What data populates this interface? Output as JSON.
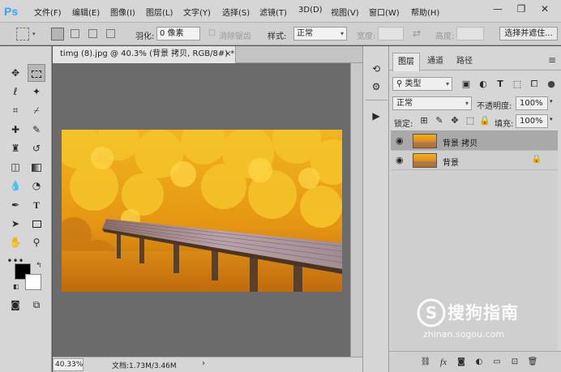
{
  "app": {
    "logo": "Ps"
  },
  "menu": [
    "文件(F)",
    "编辑(E)",
    "图像(I)",
    "图层(L)",
    "文字(Y)",
    "选择(S)",
    "滤镜(T)",
    "3D(D)",
    "视图(V)",
    "窗口(W)",
    "帮助(H)"
  ],
  "window_controls": {
    "minimize": "—",
    "restore": "❐",
    "close": "✕"
  },
  "options": {
    "feather_label": "羽化:",
    "feather_value": "0 像素",
    "antialias_label": "消除锯齿",
    "style_label": "样式:",
    "style_value": "正常",
    "width_label": "宽度:",
    "height_label": "高度:",
    "select_mask_button": "选择并遮住..."
  },
  "document": {
    "tab_title": "timg (8).jpg @ 40.3% (背景 拷贝, RGB/8#) *",
    "tab_close": "×",
    "zoom": "40.33%",
    "doc_info": "文档:1.73M/3.46M",
    "status_arrow": "›"
  },
  "layers_panel": {
    "tabs": [
      "图层",
      "通道",
      "路径"
    ],
    "active_tab": 0,
    "menu_glyph": "≡",
    "filter_kind": "类型",
    "blend_mode": "正常",
    "opacity_label": "不透明度:",
    "opacity_value": "100%",
    "lock_label": "锁定:",
    "fill_label": "填充:",
    "fill_value": "100%",
    "layers": [
      {
        "name": "背景 拷贝",
        "visible": true,
        "selected": true,
        "locked": false
      },
      {
        "name": "背景",
        "visible": true,
        "selected": false,
        "locked": true
      }
    ],
    "bottom_fx": "fx"
  },
  "watermark": {
    "main": "搜狗指南",
    "sub": "zhinan.sogou.com"
  },
  "colors": {
    "accent": "#31a8ff",
    "foreground_swatch": "#000000",
    "background_swatch": "#ffffff",
    "canvas_bg": "#6b6b6b",
    "panel_bg": "#d6d6d6"
  },
  "icons": {
    "tools": [
      "move-icon",
      "marquee-icon",
      "lasso-icon",
      "magic-wand-icon",
      "crop-icon",
      "eyedropper-icon",
      "healing-brush-icon",
      "brush-icon",
      "clone-stamp-icon",
      "history-brush-icon",
      "eraser-icon",
      "gradient-icon",
      "blur-icon",
      "dodge-icon",
      "pen-icon",
      "type-icon",
      "path-select-icon",
      "rectangle-icon",
      "hand-icon",
      "zoom-icon",
      "more-tools-icon",
      "quick-mask-icon",
      "screen-mode-icon"
    ]
  }
}
